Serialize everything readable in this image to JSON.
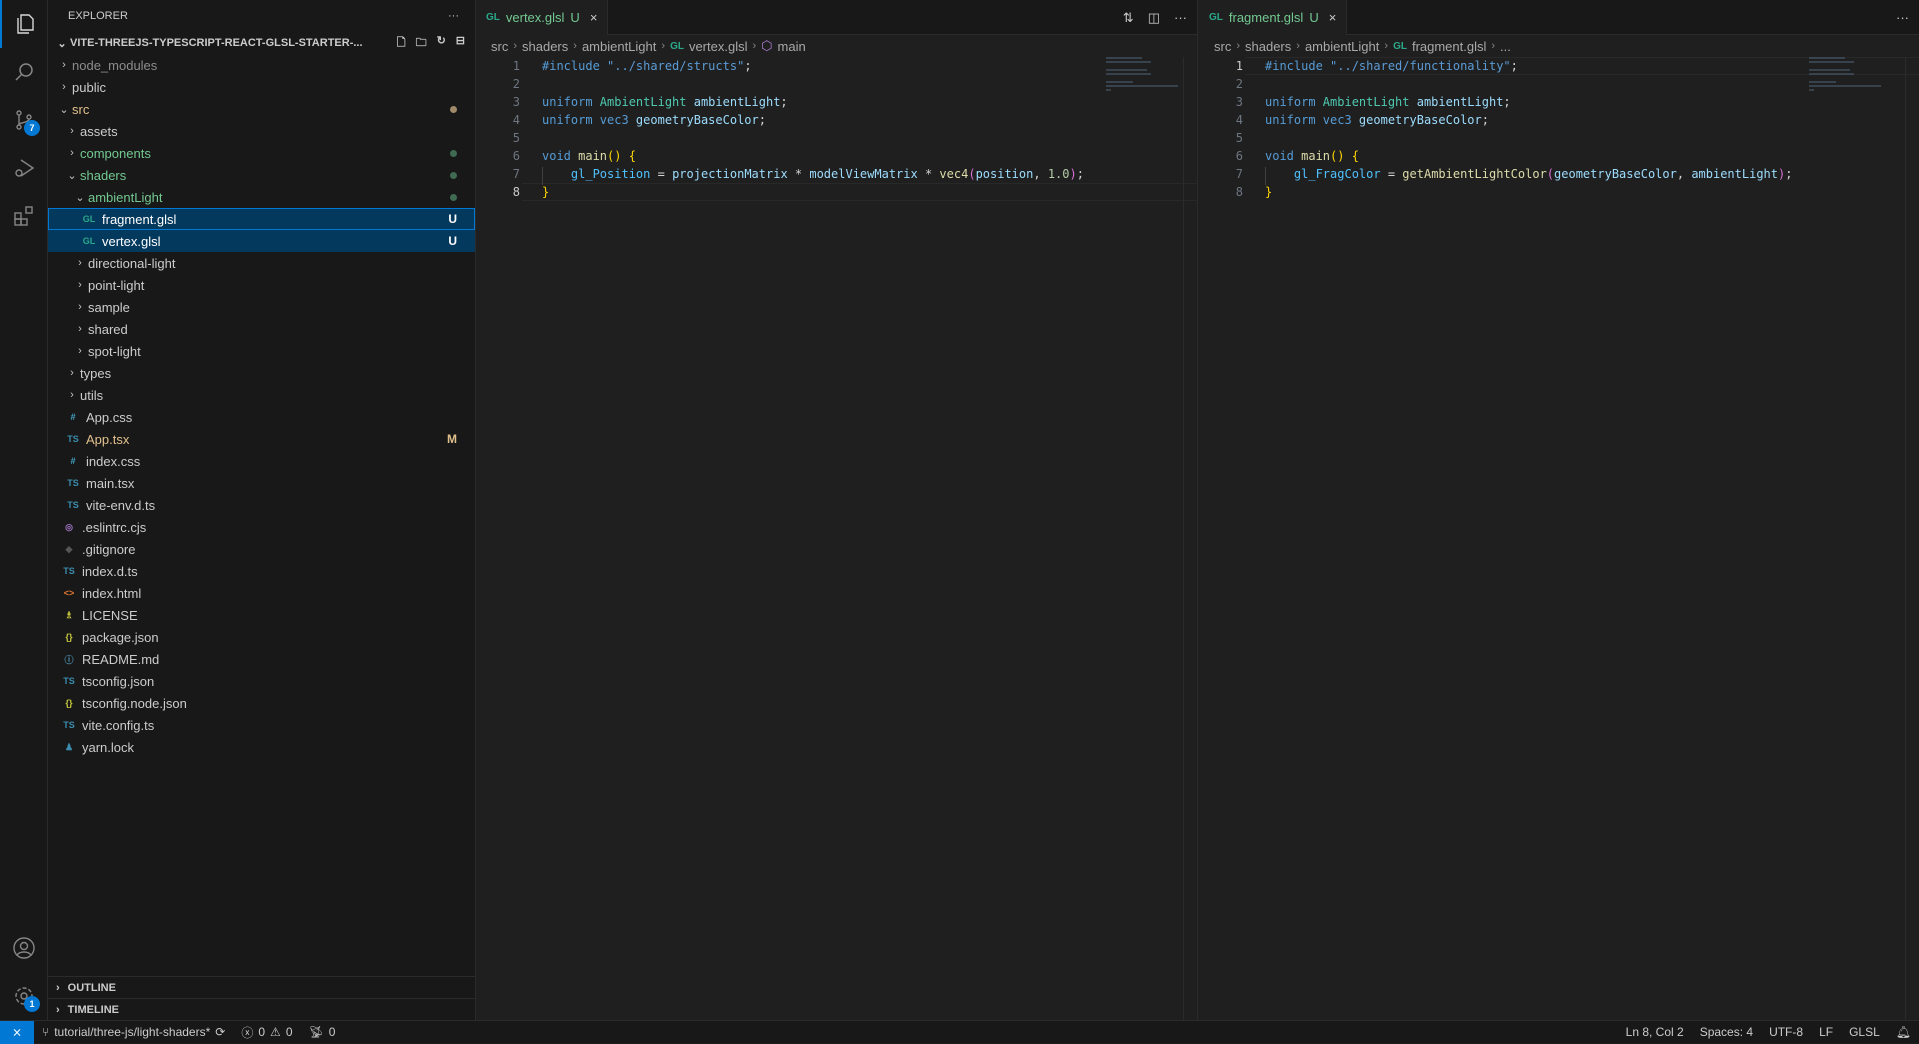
{
  "activity_bar": {
    "items": [
      {
        "name": "explorer",
        "icon": "files-icon"
      },
      {
        "name": "search",
        "icon": "search-icon"
      },
      {
        "name": "source-control",
        "icon": "source-control-icon",
        "badge": "7"
      },
      {
        "name": "run-debug",
        "icon": "debug-icon"
      },
      {
        "name": "extensions",
        "icon": "extensions-icon"
      }
    ],
    "accounts_icon": "account-icon",
    "manage_icon": "gear-icon",
    "manage_badge": "1"
  },
  "sidebar": {
    "title": "EXPLORER",
    "more": "···",
    "project": "VITE-THREEJS-TYPESCRIPT-REACT-GLSL-STARTER-...",
    "tree": [
      {
        "label": "node_modules",
        "type": "folder",
        "open": false,
        "depth": 0,
        "color": "dim"
      },
      {
        "label": "public",
        "type": "folder",
        "open": false,
        "depth": 0,
        "color": "norm"
      },
      {
        "label": "src",
        "type": "folder",
        "open": true,
        "depth": 0,
        "color": "mod",
        "dot": "#a08a6a"
      },
      {
        "label": "assets",
        "type": "folder",
        "open": false,
        "depth": 1,
        "color": "norm"
      },
      {
        "label": "components",
        "type": "folder",
        "open": false,
        "depth": 1,
        "color": "green",
        "dot": "#3f6b52"
      },
      {
        "label": "shaders",
        "type": "folder",
        "open": true,
        "depth": 1,
        "color": "green",
        "dot": "#3f6b52"
      },
      {
        "label": "ambientLight",
        "type": "folder",
        "open": true,
        "depth": 2,
        "color": "green",
        "dot": "#3f6b52"
      },
      {
        "label": "fragment.glsl",
        "type": "file",
        "icon": "GL",
        "depth": 3,
        "color": "white",
        "deco": "U",
        "selected": "focus"
      },
      {
        "label": "vertex.glsl",
        "type": "file",
        "icon": "GL",
        "depth": 3,
        "color": "white",
        "deco": "U",
        "selected": "yes"
      },
      {
        "label": "directional-light",
        "type": "folder",
        "open": false,
        "depth": 2,
        "color": "norm"
      },
      {
        "label": "point-light",
        "type": "folder",
        "open": false,
        "depth": 2,
        "color": "norm"
      },
      {
        "label": "sample",
        "type": "folder",
        "open": false,
        "depth": 2,
        "color": "norm"
      },
      {
        "label": "shared",
        "type": "folder",
        "open": false,
        "depth": 2,
        "color": "norm"
      },
      {
        "label": "spot-light",
        "type": "folder",
        "open": false,
        "depth": 2,
        "color": "norm"
      },
      {
        "label": "types",
        "type": "folder",
        "open": false,
        "depth": 1,
        "color": "norm"
      },
      {
        "label": "utils",
        "type": "folder",
        "open": false,
        "depth": 1,
        "color": "norm"
      },
      {
        "label": "App.css",
        "type": "file",
        "icon": "#",
        "depth": 1,
        "color": "norm"
      },
      {
        "label": "App.tsx",
        "type": "file",
        "icon": "TS",
        "depth": 1,
        "color": "mod",
        "deco": "M"
      },
      {
        "label": "index.css",
        "type": "file",
        "icon": "#",
        "depth": 1,
        "color": "norm"
      },
      {
        "label": "main.tsx",
        "type": "file",
        "icon": "TS",
        "depth": 1,
        "color": "norm"
      },
      {
        "label": "vite-env.d.ts",
        "type": "file",
        "icon": "TS",
        "depth": 1,
        "color": "norm"
      },
      {
        "label": ".eslintrc.cjs",
        "type": "file",
        "icon": "◎",
        "depth": 0,
        "color": "norm"
      },
      {
        "label": ".gitignore",
        "type": "file",
        "icon": "◆",
        "depth": 0,
        "color": "norm"
      },
      {
        "label": "index.d.ts",
        "type": "file",
        "icon": "TS",
        "depth": 0,
        "color": "norm"
      },
      {
        "label": "index.html",
        "type": "file",
        "icon": "<>",
        "depth": 0,
        "color": "norm"
      },
      {
        "label": "LICENSE",
        "type": "file",
        "icon": "♗",
        "depth": 0,
        "color": "norm"
      },
      {
        "label": "package.json",
        "type": "file",
        "icon": "{}",
        "depth": 0,
        "color": "norm"
      },
      {
        "label": "README.md",
        "type": "file",
        "icon": "ⓘ",
        "depth": 0,
        "color": "norm"
      },
      {
        "label": "tsconfig.json",
        "type": "file",
        "icon": "TS",
        "depth": 0,
        "color": "norm"
      },
      {
        "label": "tsconfig.node.json",
        "type": "file",
        "icon": "{}",
        "depth": 0,
        "color": "norm"
      },
      {
        "label": "vite.config.ts",
        "type": "file",
        "icon": "TS",
        "depth": 0,
        "color": "norm"
      },
      {
        "label": "yarn.lock",
        "type": "file",
        "icon": "♟",
        "depth": 0,
        "color": "norm"
      }
    ],
    "outline": "OUTLINE",
    "timeline": "TIMELINE"
  },
  "editors": [
    {
      "tab": {
        "icon": "GL",
        "label": "vertex.glsl",
        "status": "U"
      },
      "breadcrumbs": [
        "src",
        "shaders",
        "ambientLight",
        "vertex.glsl",
        "main"
      ],
      "current_line": 8,
      "lines": [
        [
          [
            "#include ",
            "directive"
          ],
          [
            "\"../shared/structs\"",
            "string"
          ],
          [
            ";",
            "punct"
          ]
        ],
        [],
        [
          [
            "uniform ",
            "keyword"
          ],
          [
            "AmbientLight ",
            "type"
          ],
          [
            "ambientLight",
            "var"
          ],
          [
            ";",
            "punct"
          ]
        ],
        [
          [
            "uniform ",
            "keyword"
          ],
          [
            "vec3 ",
            "keyword"
          ],
          [
            "geometryBaseColor",
            "var"
          ],
          [
            ";",
            "punct"
          ]
        ],
        [],
        [
          [
            "void ",
            "keyword"
          ],
          [
            "main",
            "func"
          ],
          [
            "() ",
            "brace"
          ],
          [
            "{",
            "brace"
          ]
        ],
        [
          [
            "    ",
            "punct"
          ],
          [
            "gl_Position",
            "builtin"
          ],
          [
            " = ",
            "punct"
          ],
          [
            "projectionMatrix",
            "var"
          ],
          [
            " * ",
            "punct"
          ],
          [
            "modelViewMatrix",
            "var"
          ],
          [
            " * ",
            "punct"
          ],
          [
            "vec4",
            "func"
          ],
          [
            "(",
            "paren"
          ],
          [
            "position",
            "var"
          ],
          [
            ", ",
            "punct"
          ],
          [
            "1.0",
            "num"
          ],
          [
            ")",
            "paren"
          ],
          [
            ";",
            "punct"
          ]
        ],
        [
          [
            "}",
            "brace"
          ]
        ]
      ]
    },
    {
      "tab": {
        "icon": "GL",
        "label": "fragment.glsl",
        "status": "U"
      },
      "breadcrumbs": [
        "src",
        "shaders",
        "ambientLight",
        "fragment.glsl",
        "..."
      ],
      "current_line": 1,
      "lines": [
        [
          [
            "#include ",
            "directive"
          ],
          [
            "\"../shared/functionality\"",
            "string"
          ],
          [
            ";",
            "punct"
          ]
        ],
        [],
        [
          [
            "uniform ",
            "keyword"
          ],
          [
            "AmbientLight ",
            "type"
          ],
          [
            "ambientLight",
            "var"
          ],
          [
            ";",
            "punct"
          ]
        ],
        [
          [
            "uniform ",
            "keyword"
          ],
          [
            "vec3 ",
            "keyword"
          ],
          [
            "geometryBaseColor",
            "var"
          ],
          [
            ";",
            "punct"
          ]
        ],
        [],
        [
          [
            "void ",
            "keyword"
          ],
          [
            "main",
            "func"
          ],
          [
            "() ",
            "brace"
          ],
          [
            "{",
            "brace"
          ]
        ],
        [
          [
            "    ",
            "punct"
          ],
          [
            "gl_FragColor",
            "builtin"
          ],
          [
            " = ",
            "punct"
          ],
          [
            "getAmbientLightColor",
            "func"
          ],
          [
            "(",
            "paren"
          ],
          [
            "geometryBaseColor",
            "var"
          ],
          [
            ", ",
            "punct"
          ],
          [
            "ambientLight",
            "var"
          ],
          [
            ")",
            "paren"
          ],
          [
            ";",
            "punct"
          ]
        ],
        [
          [
            "}",
            "brace"
          ]
        ]
      ]
    }
  ],
  "status": {
    "branch": "tutorial/three-js/light-shaders*",
    "errors": "0",
    "warnings": "0",
    "ports": "0",
    "position": "Ln 8, Col 2",
    "spaces": "Spaces: 4",
    "encoding": "UTF-8",
    "eol": "LF",
    "language": "GLSL"
  }
}
